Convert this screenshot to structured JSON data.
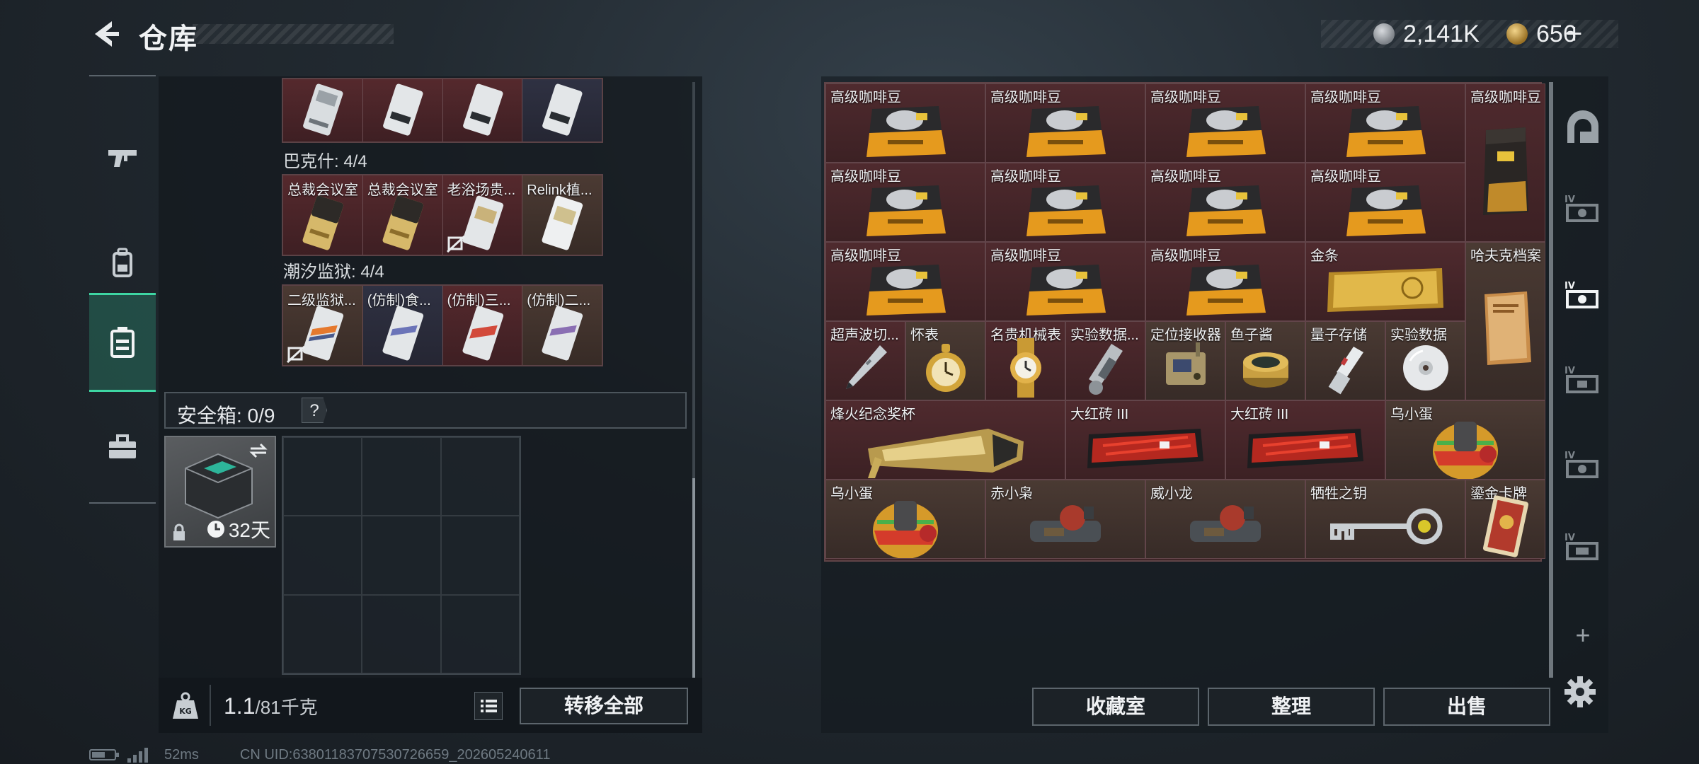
{
  "header": {
    "title": "仓库",
    "currency_silver": "2,141K",
    "currency_gold": "656",
    "add_label": "+"
  },
  "left_rail": {
    "tabs": [
      {
        "icon": "gun-icon"
      },
      {
        "icon": "backpack-icon"
      },
      {
        "icon": "container-icon",
        "active": true
      },
      {
        "icon": "toolbox-icon"
      }
    ]
  },
  "card_groups": {
    "top_row": {
      "cards": [
        {
          "label": "",
          "color": "red"
        },
        {
          "label": "",
          "color": "red"
        },
        {
          "label": "",
          "color": "red"
        },
        {
          "label": "",
          "color": "blue"
        }
      ]
    },
    "group1": {
      "title": "巴克什: 4/4",
      "cards": [
        {
          "label": "总裁会议室",
          "color": "red"
        },
        {
          "label": "总裁会议室",
          "color": "red"
        },
        {
          "label": "老浴场贵...",
          "color": "red",
          "nosell": true
        },
        {
          "label": "Relink植...",
          "color": "brown"
        }
      ]
    },
    "group2": {
      "title": "潮汐监狱: 4/4",
      "cards": [
        {
          "label": "二级监狱...",
          "color": "brown",
          "nosell": true
        },
        {
          "label": "(仿制)食...",
          "color": "blue"
        },
        {
          "label": "(仿制)三...",
          "color": "red"
        },
        {
          "label": "(仿制)二...",
          "color": "brown"
        }
      ]
    }
  },
  "safe_box": {
    "label": "安全箱: 0/9",
    "help": "?",
    "days": "32天"
  },
  "weight": {
    "current": "1.1",
    "max": "/81千克"
  },
  "buttons": {
    "transfer_all": "转移全部",
    "collection": "收藏室",
    "organize": "整理",
    "sell": "出售"
  },
  "inventory": {
    "items": [
      {
        "label": "高级咖啡豆",
        "art": "coffee-bag"
      },
      {
        "label": "高级咖啡豆",
        "art": "coffee-bag"
      },
      {
        "label": "高级咖啡豆",
        "art": "coffee-bag"
      },
      {
        "label": "高级咖啡豆",
        "art": "coffee-bag"
      },
      {
        "label": "高级咖啡豆",
        "art": "coffee-bag-tall"
      },
      {
        "label": "高级咖啡豆",
        "art": "coffee-bag"
      },
      {
        "label": "高级咖啡豆",
        "art": "coffee-bag"
      },
      {
        "label": "高级咖啡豆",
        "art": "coffee-bag"
      },
      {
        "label": "高级咖啡豆",
        "art": "coffee-bag"
      },
      {
        "label": "高级咖啡豆",
        "art": "coffee-bag"
      },
      {
        "label": "高级咖啡豆",
        "art": "coffee-bag"
      },
      {
        "label": "高级咖啡豆",
        "art": "coffee-bag"
      },
      {
        "label": "金条",
        "art": "gold-bar"
      },
      {
        "label": "哈夫克档案",
        "art": "folder"
      },
      {
        "label": "超声波切...",
        "art": "pen"
      },
      {
        "label": "怀表",
        "art": "pocket-watch"
      },
      {
        "label": "名贵机械表",
        "art": "wristwatch"
      },
      {
        "label": "实验数据...",
        "art": "device"
      },
      {
        "label": "定位接收器",
        "art": "receiver"
      },
      {
        "label": "鱼子酱",
        "art": "caviar"
      },
      {
        "label": "量子存储",
        "art": "usb"
      },
      {
        "label": "实验数据",
        "art": "disc"
      },
      {
        "label": "烽火纪念奖杯",
        "art": "trophy"
      },
      {
        "label": "大红砖 III",
        "art": "red-brick"
      },
      {
        "label": "大红砖 III",
        "art": "red-brick"
      },
      {
        "label": "乌小蛋",
        "art": "egg-figure"
      },
      {
        "label": "乌小蛋",
        "art": "egg-figure"
      },
      {
        "label": "赤小枭",
        "art": "figure"
      },
      {
        "label": "威小龙",
        "art": "figure"
      },
      {
        "label": "牺牲之钥",
        "art": "key"
      },
      {
        "label": "鎏金卡牌",
        "art": "card"
      }
    ]
  },
  "right_rail": {
    "items": [
      {
        "icon": "arch-icon"
      },
      {
        "icon": "storage-iv-icon"
      },
      {
        "icon": "storage-iv-icon",
        "active": true
      },
      {
        "icon": "storage-iv-icon"
      },
      {
        "icon": "storage-iv-icon"
      },
      {
        "icon": "storage-iv-icon"
      }
    ],
    "add_label": "+"
  },
  "status": {
    "ping": "52ms",
    "uid": "CN UID:6380118370753072665​9_202605240611"
  },
  "colors": {
    "accent": "#3ed6a3",
    "item_red": "#4f2a2e",
    "item_brown": "#4a3a33"
  }
}
